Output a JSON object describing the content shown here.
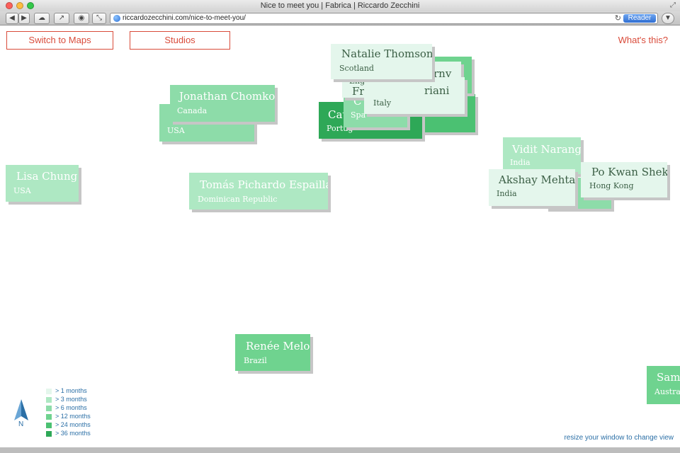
{
  "window": {
    "title": "Nice to meet you | Fabrica | Riccardo Zecchini",
    "url": "riccardozecchini.com/nice-to-meet-you/",
    "reader_label": "Reader"
  },
  "nav": {
    "switch_label": "Switch to Maps",
    "studios_label": "Studios",
    "whats_this": "What's this?"
  },
  "cards": {
    "natalie": {
      "name": "Natalie Thomson",
      "country": "Scotland"
    },
    "england": {
      "name": "",
      "country": "England"
    },
    "italy_name_partial": {
      "name": "riani",
      "country": "Italy"
    },
    "rny": {
      "name": "rny",
      "country": ""
    },
    "fra_partial": {
      "name": "Fra",
      "country": ""
    },
    "cat": {
      "name": "Cat",
      "country": "Portug"
    },
    "spa": {
      "name": "C",
      "country": "Spa"
    },
    "jonathan": {
      "name": "Jonathan Chomko",
      "country": "Canada"
    },
    "usa_back": {
      "name": "",
      "country": "USA"
    },
    "lisa": {
      "name": "Lisa Chung",
      "country": "USA"
    },
    "tomas": {
      "name": "Tomás Pichardo Espaillat",
      "country": "Dominican Republic"
    },
    "vidit": {
      "name": "Vidit Narang",
      "country": "India"
    },
    "akshay": {
      "name": "Akshay Mehta",
      "country": "India"
    },
    "pokwan": {
      "name": "Po Kwan Shek",
      "country": "Hong Kong"
    },
    "renee": {
      "name": "Renée Melo",
      "country": "Brazil"
    },
    "sam": {
      "name": "Sam",
      "country": "Austra"
    }
  },
  "legend": [
    {
      "label": "> 1 months",
      "color": "#e4f6ec"
    },
    {
      "label": "> 3 months",
      "color": "#aee8c3"
    },
    {
      "label": "> 6 months",
      "color": "#8ddca9"
    },
    {
      "label": "> 12 months",
      "color": "#6fd38f"
    },
    {
      "label": "> 24 months",
      "color": "#4bc172"
    },
    {
      "label": "> 36 months",
      "color": "#2ea857"
    }
  ],
  "compass": {
    "label": "N",
    "icon": "north-arrow-icon"
  },
  "footer": {
    "resize_note": "resize your window to change view"
  }
}
